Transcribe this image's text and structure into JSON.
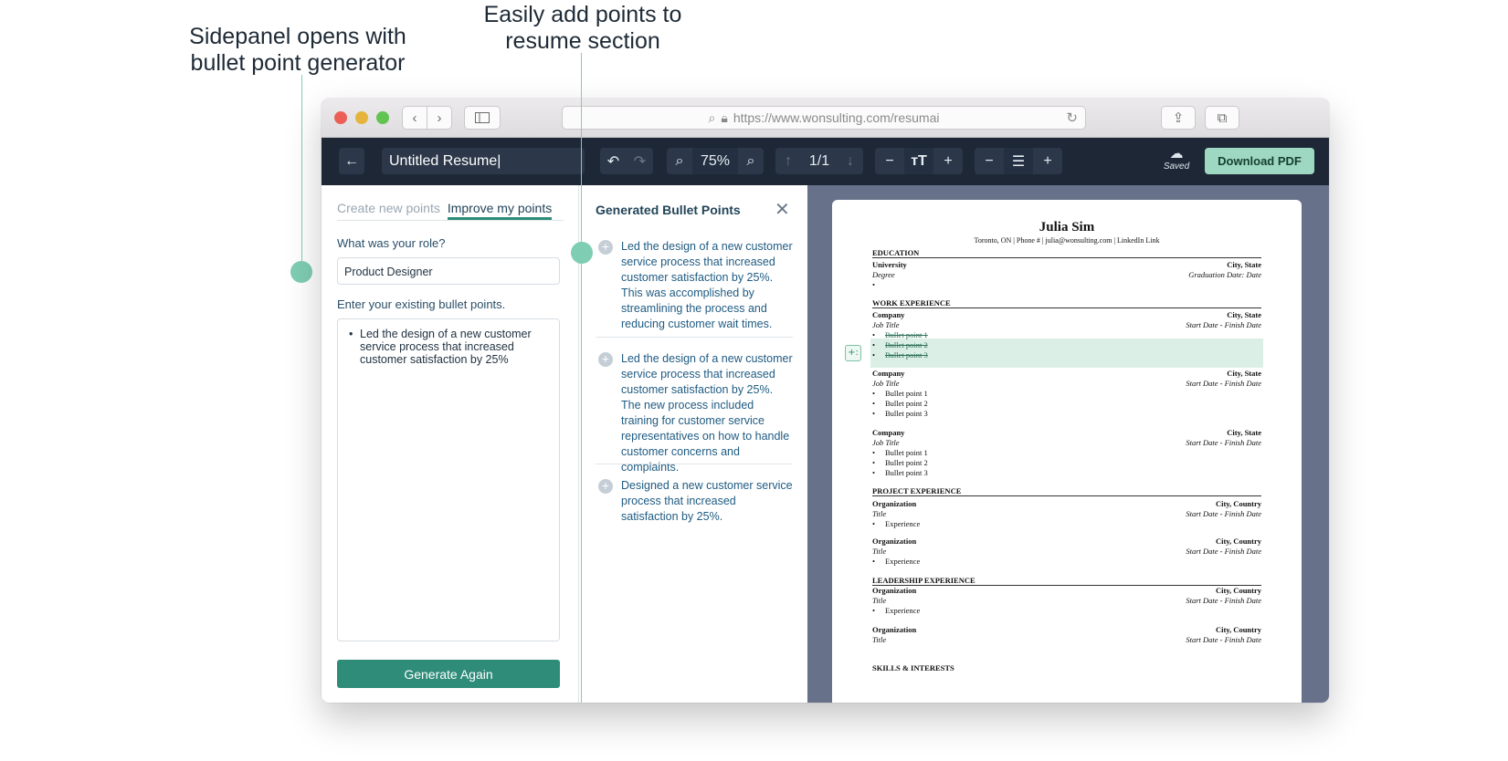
{
  "callouts": {
    "sidepanel": "Sidepanel opens with bullet point generator",
    "add_points": "Easily add points to resume section"
  },
  "colors": {
    "accent": "#2e8c79",
    "toolbar": "#1d2736",
    "callout_line": "#7fcdb3",
    "download_bg": "#9fd8c2"
  },
  "browser": {
    "url": "https://www.wonsulting.com/resumai",
    "icons": [
      "back-icon",
      "forward-icon",
      "sidebar-icon",
      "search-icon",
      "lock-icon",
      "reload-icon",
      "share-icon",
      "tabs-icon"
    ]
  },
  "toolbar": {
    "doc_title": "Untitled Resume|",
    "zoom": "75%",
    "page": "1/1",
    "saved": "Saved",
    "download": "Download PDF",
    "icons": [
      "arrow-left-icon",
      "undo-icon",
      "redo-icon",
      "zoom-out-icon",
      "zoom-in-icon",
      "arrow-up-icon",
      "arrow-down-icon",
      "minus-icon",
      "font-size-icon",
      "plus-icon",
      "line-spacing-icon",
      "cloud-check-icon"
    ]
  },
  "left_panel": {
    "tab_create": "Create new points",
    "tab_improve": "Improve my points",
    "role_label": "What was your role?",
    "role_value": "Product Designer",
    "bullets_label": "Enter your existing bullet points.",
    "bullet_bullet": "•",
    "bullets_value": "Led the design of a new customer service process that increased customer satisfaction by 25%",
    "generate": "Generate Again"
  },
  "generated": {
    "title": "Generated Bullet Points",
    "close": "✕",
    "add": "+",
    "items": [
      "Led the design of a new customer service process that increased customer satisfaction by 25%. This was accomplished by streamlining the process and reducing customer wait times.",
      "Led the design of a new customer service process that increased customer satisfaction by 25%. The new process included training for customer service representatives on how to handle customer concerns and complaints.",
      "Designed a new customer service process that increased satisfaction by 25%."
    ]
  },
  "resume": {
    "name": "Julia Sim",
    "contact": "Toronto, ON | Phone # | julia@wonsulting.com | LinkedIn Link",
    "bullet": "•",
    "ai_button": "+:",
    "education": {
      "header": "EDUCATION",
      "school": "University",
      "location": "City, State",
      "degree": "Degree",
      "date": "Graduation Date: Date"
    },
    "work": {
      "header": "WORK EXPERIENCE",
      "company": "Company",
      "location": "City, State",
      "title": "Job Title",
      "dates": "Start Date - Finish Date",
      "bullets": [
        "Bullet point 1",
        "Bullet point 2",
        "Bullet point 3"
      ]
    },
    "projects": {
      "header": "PROJECT EXPERIENCE",
      "org": "Organization",
      "location": "City, Country",
      "title": "Title",
      "dates": "Start Date - Finish Date",
      "bullet": "Experience"
    },
    "leadership": {
      "header": "LEADERSHIP EXPERIENCE",
      "org": "Organization",
      "location": "City, Country",
      "title": "Title",
      "dates": "Start Date - Finish Date",
      "bullet": "Experience"
    },
    "skills_header": "SKILLS & INTERESTS"
  }
}
